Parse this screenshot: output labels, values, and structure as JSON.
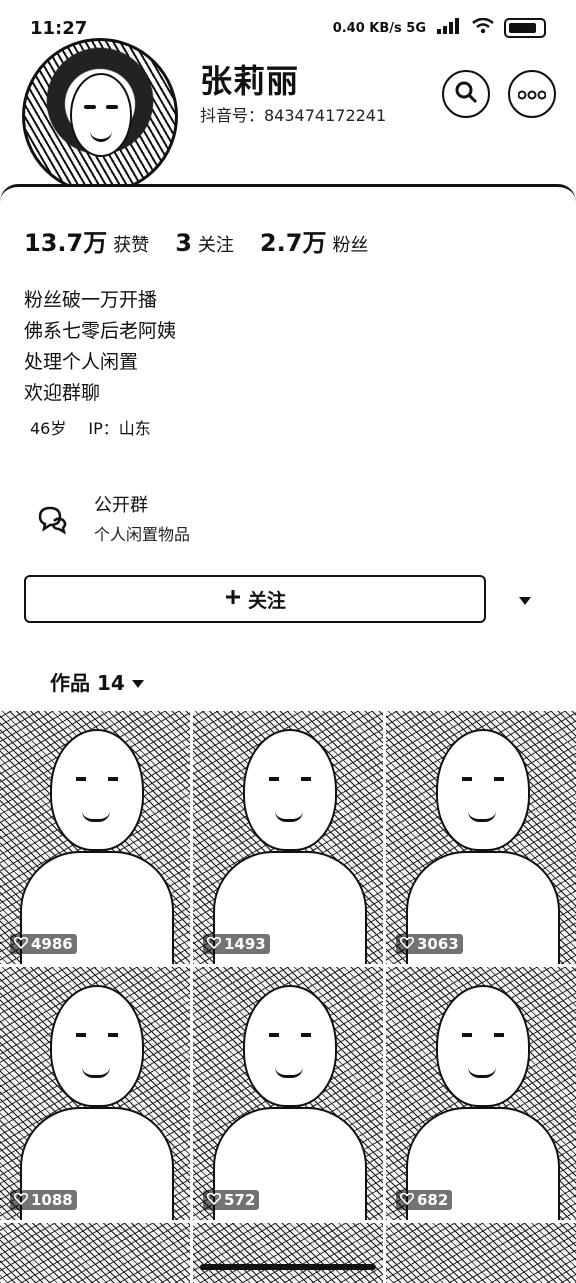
{
  "status_bar": {
    "time": "11:27",
    "network": "0.40 KB/s 5G"
  },
  "profile": {
    "name": "张莉丽",
    "account": "抖音号：843474172241"
  },
  "stats": [
    {
      "num": "13.7万",
      "label": "获赞"
    },
    {
      "num": "3",
      "label": "关注"
    },
    {
      "num": "2.7万",
      "label": "粉丝"
    }
  ],
  "bio": [
    "粉丝破一万开播",
    "佛系七零后老阿姨",
    "处理个人闲置",
    "欢迎群聊"
  ],
  "meta": {
    "age": "46岁",
    "ip": "IP：山东"
  },
  "group": {
    "title": "公开群",
    "subtitle": "个人闲置物品"
  },
  "actions": {
    "follow_label": "关注"
  },
  "works": {
    "label": "作品 14"
  },
  "videos": [
    {
      "likes": "4986"
    },
    {
      "likes": "1493"
    },
    {
      "likes": "3063"
    },
    {
      "likes": "1088"
    },
    {
      "likes": "572"
    },
    {
      "likes": "682"
    }
  ]
}
